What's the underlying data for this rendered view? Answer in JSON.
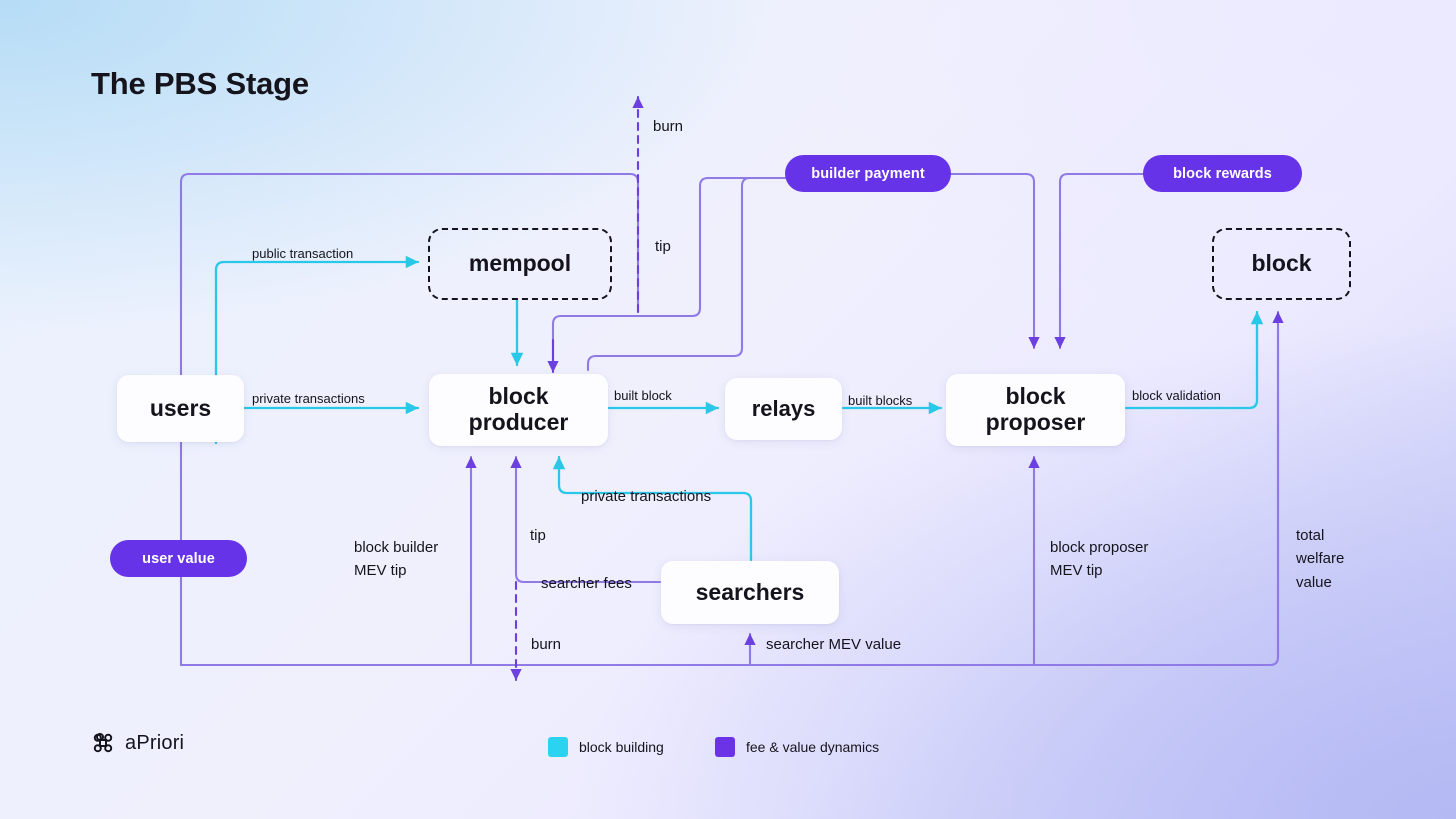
{
  "page": {
    "title": "The PBS Stage"
  },
  "theme": {
    "cyan": "#2ac8e8",
    "purple": "#7a5ae0",
    "pill_purple": "#6733e8",
    "legend_cyan": "#2bd3f0",
    "legend_purple": "#6c32e8",
    "ink": "#15141c"
  },
  "nodes": [
    {
      "id": "users",
      "label": "users",
      "style": "solid"
    },
    {
      "id": "mempool",
      "label": "mempool",
      "style": "dashed"
    },
    {
      "id": "block-producer",
      "label": "block\nproducer",
      "style": "solid"
    },
    {
      "id": "relays",
      "label": "relays",
      "style": "solid"
    },
    {
      "id": "block-proposer",
      "label": "block\nproposer",
      "style": "solid"
    },
    {
      "id": "block",
      "label": "block",
      "style": "dashed"
    },
    {
      "id": "searchers",
      "label": "searchers",
      "style": "solid"
    }
  ],
  "pills": [
    {
      "id": "user-value",
      "label": "user value"
    },
    {
      "id": "builder-payment",
      "label": "builder payment"
    },
    {
      "id": "block-rewards",
      "label": "block rewards"
    }
  ],
  "edge_labels": [
    {
      "id": "public-transaction",
      "text": "public transaction"
    },
    {
      "id": "private-transactions",
      "text": "private transactions"
    },
    {
      "id": "built-block",
      "text": "built block"
    },
    {
      "id": "built-blocks",
      "text": "built blocks"
    },
    {
      "id": "block-validation",
      "text": "block validation"
    },
    {
      "id": "burn-top",
      "text": "burn"
    },
    {
      "id": "tip-top",
      "text": "tip"
    },
    {
      "id": "tip-bottom",
      "text": "tip"
    },
    {
      "id": "block-builder-mev-tip",
      "text": "block builder\nMEV tip"
    },
    {
      "id": "block-proposer-mev-tip",
      "text": "block proposer\nMEV tip"
    },
    {
      "id": "total-welfare-value",
      "text": "total\nwelfare\nvalue"
    },
    {
      "id": "searcher-fees",
      "text": "searcher fees"
    },
    {
      "id": "private-transactions-searchers",
      "text": "private transactions"
    },
    {
      "id": "burn-bottom",
      "text": "burn"
    },
    {
      "id": "searcher-mev-value",
      "text": "searcher MEV value"
    }
  ],
  "legend": {
    "items": [
      {
        "id": "block-building",
        "label": "block building",
        "color": "#2bd3f0"
      },
      {
        "id": "fee-value-dynamics",
        "label": "fee & value dynamics",
        "color": "#6c32e8"
      }
    ]
  },
  "brand": {
    "name": "aPriori",
    "logo_icon": "clover-logo-icon"
  }
}
